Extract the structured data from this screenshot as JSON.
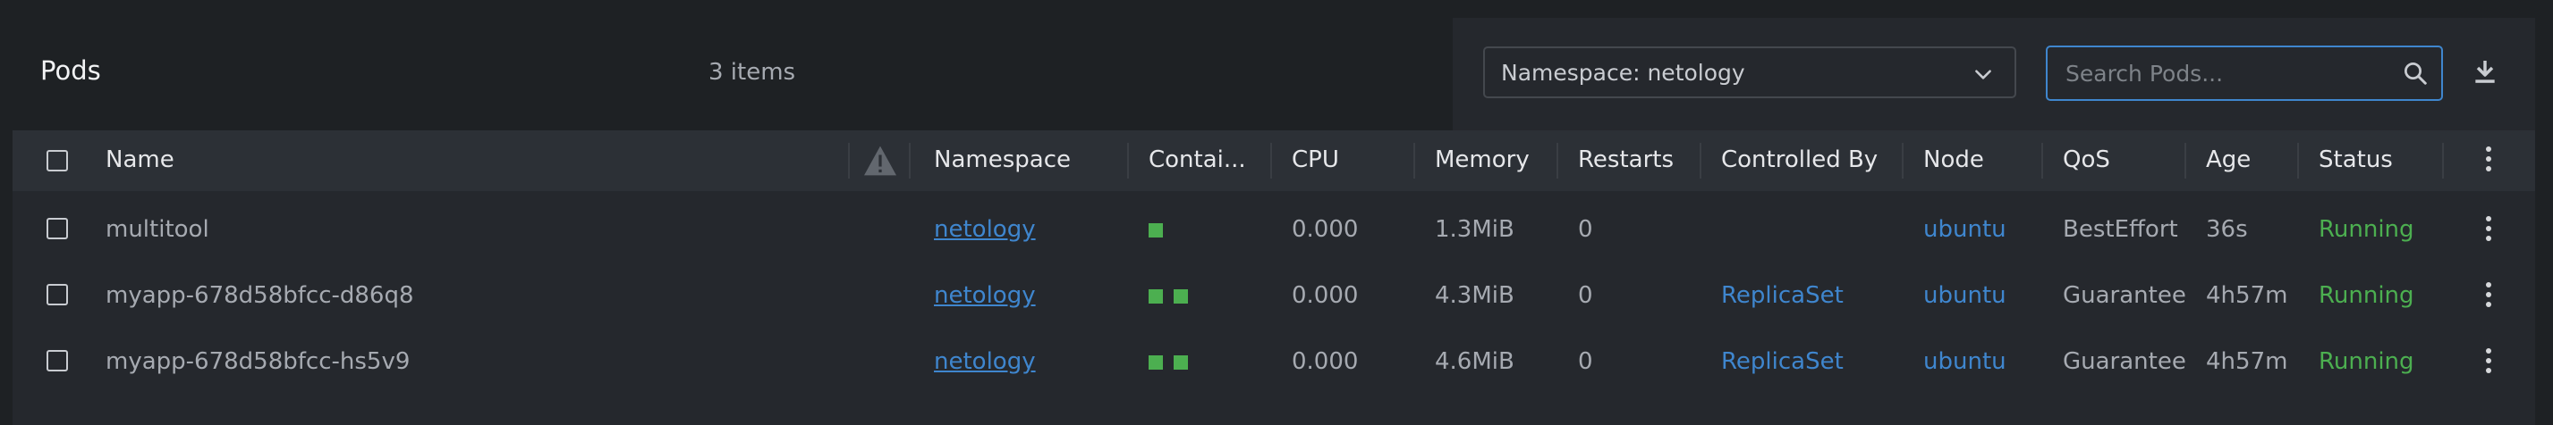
{
  "header": {
    "title": "Pods",
    "count": "3 items",
    "namespace_select": "Namespace: netology",
    "search_placeholder": "Search Pods..."
  },
  "columns": {
    "name": "Name",
    "namespace": "Namespace",
    "containers": "Contai...",
    "cpu": "CPU",
    "memory": "Memory",
    "restarts": "Restarts",
    "controlled_by": "Controlled By",
    "node": "Node",
    "qos": "QoS",
    "age": "Age",
    "status": "Status"
  },
  "rows": [
    {
      "name": "multitool",
      "namespace": "netology",
      "containers": 1,
      "cpu": "0.000",
      "memory": "1.3MiB",
      "restarts": "0",
      "controlled_by": "",
      "node": "ubuntu",
      "qos": "BestEffort",
      "age": "36s",
      "status": "Running"
    },
    {
      "name": "myapp-678d58bfcc-d86q8",
      "namespace": "netology",
      "containers": 2,
      "cpu": "0.000",
      "memory": "4.3MiB",
      "restarts": "0",
      "controlled_by": "ReplicaSet",
      "node": "ubuntu",
      "qos": "Guarantee",
      "age": "4h57m",
      "status": "Running"
    },
    {
      "name": "myapp-678d58bfcc-hs5v9",
      "namespace": "netology",
      "containers": 2,
      "cpu": "0.000",
      "memory": "4.6MiB",
      "restarts": "0",
      "controlled_by": "ReplicaSet",
      "node": "ubuntu",
      "qos": "Guarantee",
      "age": "4h57m",
      "status": "Running"
    }
  ],
  "colors": {
    "background": "#1e2124",
    "panel": "#25282d",
    "header_row": "#2c3036",
    "link": "#3f86ce",
    "running": "#4caf50",
    "container_ready": "#4caf50"
  },
  "icons": [
    "chevron-down-icon",
    "search-icon",
    "download-icon",
    "warning-icon",
    "kebab-menu-icon"
  ]
}
